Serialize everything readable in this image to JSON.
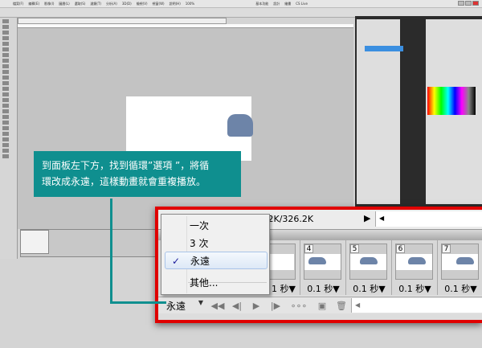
{
  "menubar": {
    "items": [
      "檔案(F)",
      "編輯(E)",
      "影像(I)",
      "圖層(L)",
      "選取(S)",
      "濾鏡(T)",
      "分析(A)",
      "3D(D)",
      "檢視(V)",
      "視窗(W)",
      "說明(H)"
    ],
    "zoom": "100%",
    "workspace": "基本功能",
    "workspace_items": [
      "設計",
      "繪畫"
    ],
    "cs_live": "CS Live"
  },
  "callout": {
    "line1": "到面板左下方，找到循環”選項 ”，將循",
    "line2": "環改成永遠，這樣動畫就會重複播放。"
  },
  "animation_panel": {
    "size_readout": "366.2K/326.2K",
    "frames": [
      {
        "number": "4",
        "delay": "0.1 秒▼"
      },
      {
        "number": "5",
        "delay": "0.1 秒▼"
      },
      {
        "number": "6",
        "delay": "0.1 秒▼"
      },
      {
        "number": "7",
        "delay": "0.1 秒▼"
      }
    ],
    "hidden_frame_delay": "1 秒▼",
    "loop_value": "永遠",
    "loop_arrow": "▼"
  },
  "loop_menu": {
    "items": [
      "一次",
      "3 次",
      "永遠",
      "其他..."
    ],
    "selected": "永遠",
    "check": "✓"
  },
  "colors": {
    "accent": "#0f8f8f",
    "highlight": "#e00000"
  }
}
